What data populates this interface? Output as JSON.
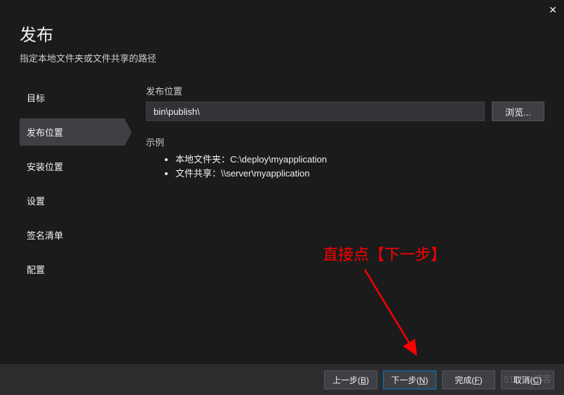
{
  "window": {
    "title": "发布",
    "subtitle": "指定本地文件夹或文件共享的路径"
  },
  "sidebar": {
    "items": [
      {
        "label": "目标"
      },
      {
        "label": "发布位置"
      },
      {
        "label": "安装位置"
      },
      {
        "label": "设置"
      },
      {
        "label": "签名清单"
      },
      {
        "label": "配置"
      }
    ]
  },
  "content": {
    "publish_location_label": "发布位置",
    "publish_location_value": "bin\\publish\\",
    "browse_label": "浏览...",
    "example_label": "示例",
    "examples": [
      "本地文件夹：C:\\deploy\\myapplication",
      "文件共享：\\\\server\\myapplication"
    ]
  },
  "footer": {
    "prev": {
      "text": "上一步(",
      "key": "B",
      "suffix": ")"
    },
    "next": {
      "text": "下一步(",
      "key": "N",
      "suffix": ")"
    },
    "finish": {
      "text": "完成(",
      "key": "F",
      "suffix": ")"
    },
    "cancel": {
      "text": "取消(",
      "key": "C",
      "suffix": ")"
    }
  },
  "annotation": {
    "text": "直接点【下一步】"
  },
  "watermark": "51CTO博客"
}
